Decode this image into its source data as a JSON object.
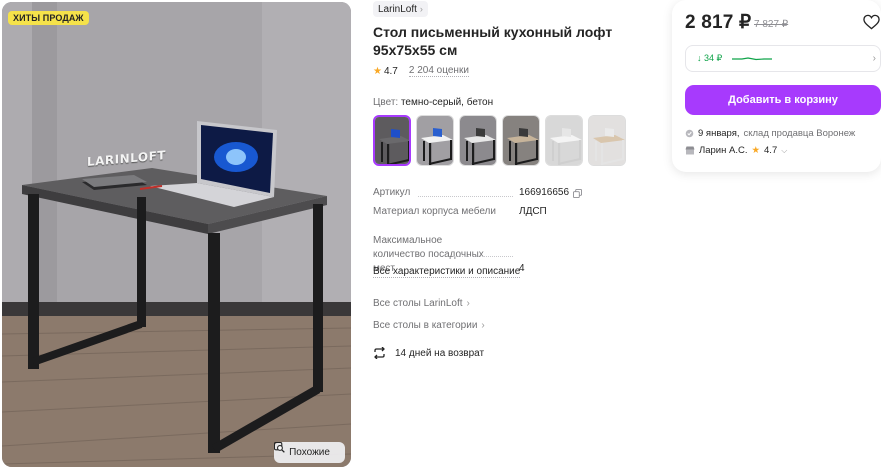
{
  "photo": {
    "badge": "ХИТЫ ПРОДАЖ",
    "brand_sign": "LARINLOFT",
    "similar_label": "Похожие"
  },
  "product": {
    "brand": "LarinLoft",
    "title": "Стол письменный кухонный лофт 95х75х55 см",
    "rating": "4.7",
    "reviews": "2 204 оценки",
    "color_label": "Цвет:",
    "color_value": "темно-серый, бетон",
    "swatch_count": 6
  },
  "specs": [
    {
      "key": "Артикул",
      "value": "166916656"
    },
    {
      "key": "Материал корпуса мебели",
      "value": "ЛДСП"
    },
    {
      "key": "Максимальное количество посадочных мест",
      "value": "4"
    }
  ],
  "all_specs_link": "Все характеристики и описание",
  "links": {
    "brand_tables": "Все столы LarinLoft",
    "category_tables": "Все столы в категории"
  },
  "return_policy": "14 дней на возврат",
  "buy": {
    "price": "2 817 ₽",
    "old_price": "7 827 ₽",
    "price_change": "↓ 34 ₽",
    "cart_button": "Добавить в корзину",
    "delivery_date": "9 января,",
    "delivery_from": "склад продавца Воронеж",
    "seller_name": "Ларин А.С.",
    "seller_rating": "4.7"
  },
  "colors": {
    "accent": "#a73afd",
    "badge": "#f5e24a",
    "star": "#f9a825",
    "green": "#0fa349"
  }
}
